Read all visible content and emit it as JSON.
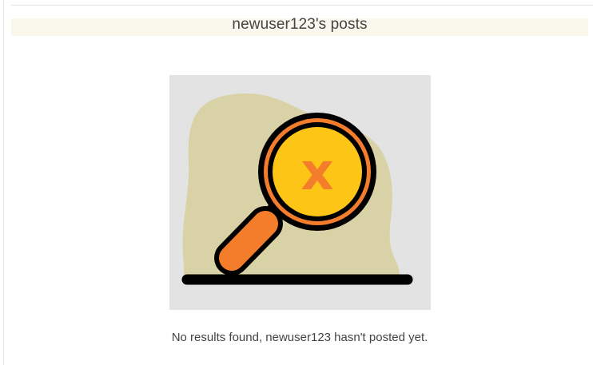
{
  "page": {
    "title": "newuser123's posts",
    "empty_message": "No results found, newuser123 hasn't posted yet."
  },
  "illustration": {
    "icon": "magnifier-no-results-icon",
    "mark": "x"
  },
  "colors": {
    "title_bar_bg": "#faf7ec",
    "illustration_bg": "#e3e3e3",
    "blob": "#d9d2a6",
    "lens_fill": "#fdc515",
    "accent_orange": "#f47d2c",
    "outline": "#000000",
    "text": "#444444"
  }
}
